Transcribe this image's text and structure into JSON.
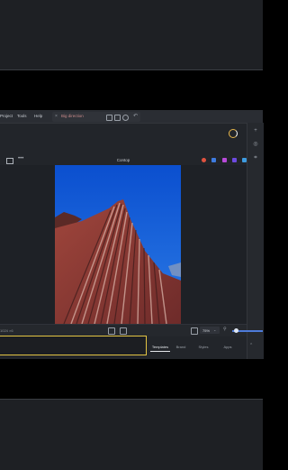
{
  "menu": {
    "items": [
      "Project",
      "Tools",
      "Help"
    ]
  },
  "document": {
    "tab_title": "Big direction"
  },
  "canvas": {
    "title": "Contop",
    "colors": {
      "sky": "#1560d8",
      "rock": "#8b3a34",
      "spinner": "#e8b74a",
      "accent": "#4e7bd9"
    }
  },
  "status": {
    "page_info": "1024 ×6",
    "zoom": "75%",
    "zoom_chevron": "⌄"
  },
  "tabs": [
    "Templates",
    "Brand",
    "Styles",
    "Apps"
  ]
}
